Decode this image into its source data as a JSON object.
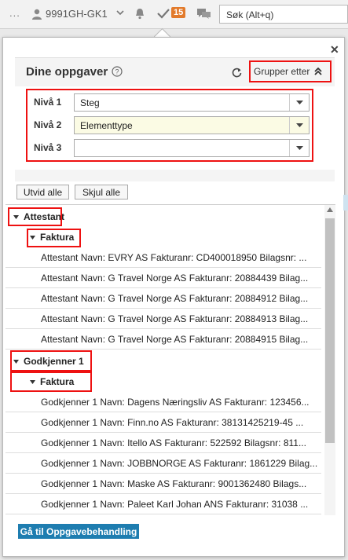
{
  "topbar": {
    "ellipsis": "...",
    "user": "9991GH-GK1",
    "badge": "15",
    "search_placeholder": "Søk (Alt+q)"
  },
  "panel": {
    "title": "Dine oppgaver",
    "group_by_label": "Grupper etter",
    "levels": [
      {
        "label": "Nivå 1",
        "value": "Steg"
      },
      {
        "label": "Nivå 2",
        "value": "Elementtype"
      },
      {
        "label": "Nivå 3",
        "value": ""
      }
    ],
    "expand_all": "Utvid alle",
    "collapse_all": "Skjul alle",
    "groups": [
      {
        "name": "Attestant",
        "sub": "Faktura",
        "rows": [
          "Attestant Navn: EVRY AS Fakturanr: CD400018950 Bilagsnr: ...",
          "Attestant Navn: G Travel Norge AS Fakturanr: 20884439 Bilag...",
          "Attestant Navn: G Travel Norge AS Fakturanr: 20884912 Bilag...",
          "Attestant Navn: G Travel Norge AS Fakturanr: 20884913 Bilag...",
          "Attestant Navn: G Travel Norge AS Fakturanr: 20884915 Bilag..."
        ]
      },
      {
        "name": "Godkjenner 1",
        "sub": "Faktura",
        "rows": [
          "Godkjenner 1 Navn: Dagens Næringsliv AS Fakturanr: 123456...",
          "Godkjenner 1 Navn: Finn.no AS Fakturanr: 38131425219-45 ...",
          "Godkjenner 1 Navn: Itello AS Fakturanr: 522592 Bilagsnr: 811...",
          "Godkjenner 1 Navn: JOBBNORGE AS Fakturanr: 1861229 Bilag...",
          "Godkjenner 1 Navn: Maske AS Fakturanr: 9001362480 Bilags...",
          "Godkjenner 1 Navn: Paleet Karl Johan ANS Fakturanr: 31038 ..."
        ]
      }
    ],
    "footer_button": "Gå til Oppgavebehandling"
  }
}
